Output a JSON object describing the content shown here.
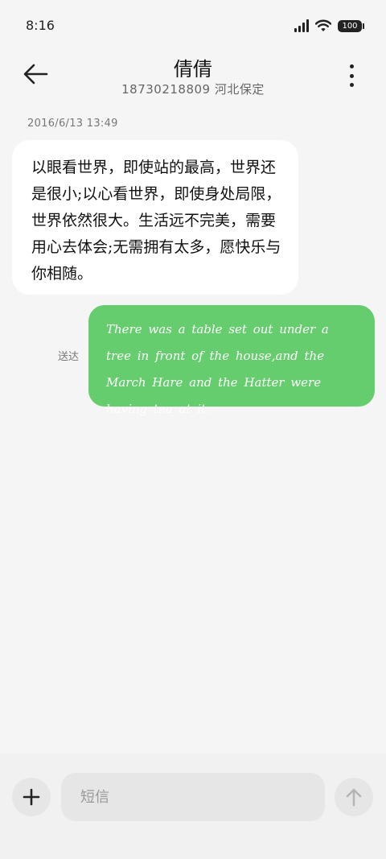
{
  "status_bar": {
    "time": "8:16",
    "battery": "100",
    "icons": [
      "signal-icon",
      "wifi-icon",
      "battery-icon"
    ]
  },
  "header": {
    "contact_name": "倩倩",
    "contact_subtitle": "18730218809 河北保定",
    "icons": [
      "back-arrow-icon",
      "more-vertical-icon"
    ]
  },
  "conversation": {
    "timestamp": "2016/6/13 13:49",
    "messages": [
      {
        "direction": "incoming",
        "text": "以眼看世界，即使站的最高，世界还是很小;以心看世界，即使身处局限，世界依然很大。生活远不完美，需要用心去体会;无需拥有太多，愿快乐与你相随。"
      },
      {
        "direction": "outgoing",
        "status": "送达",
        "text": "There was a table set out under a tree in front of the house,and the March Hare and the Hatter were having tea at it."
      }
    ]
  },
  "composer": {
    "placeholder": "短信",
    "value": "",
    "icons": [
      "plus-icon",
      "send-arrow-icon"
    ]
  },
  "colors": {
    "background": "#f5f5f5",
    "incoming_bubble": "#ffffff",
    "outgoing_bubble": "#66cd6e",
    "composer_control": "#e6e6e6"
  }
}
